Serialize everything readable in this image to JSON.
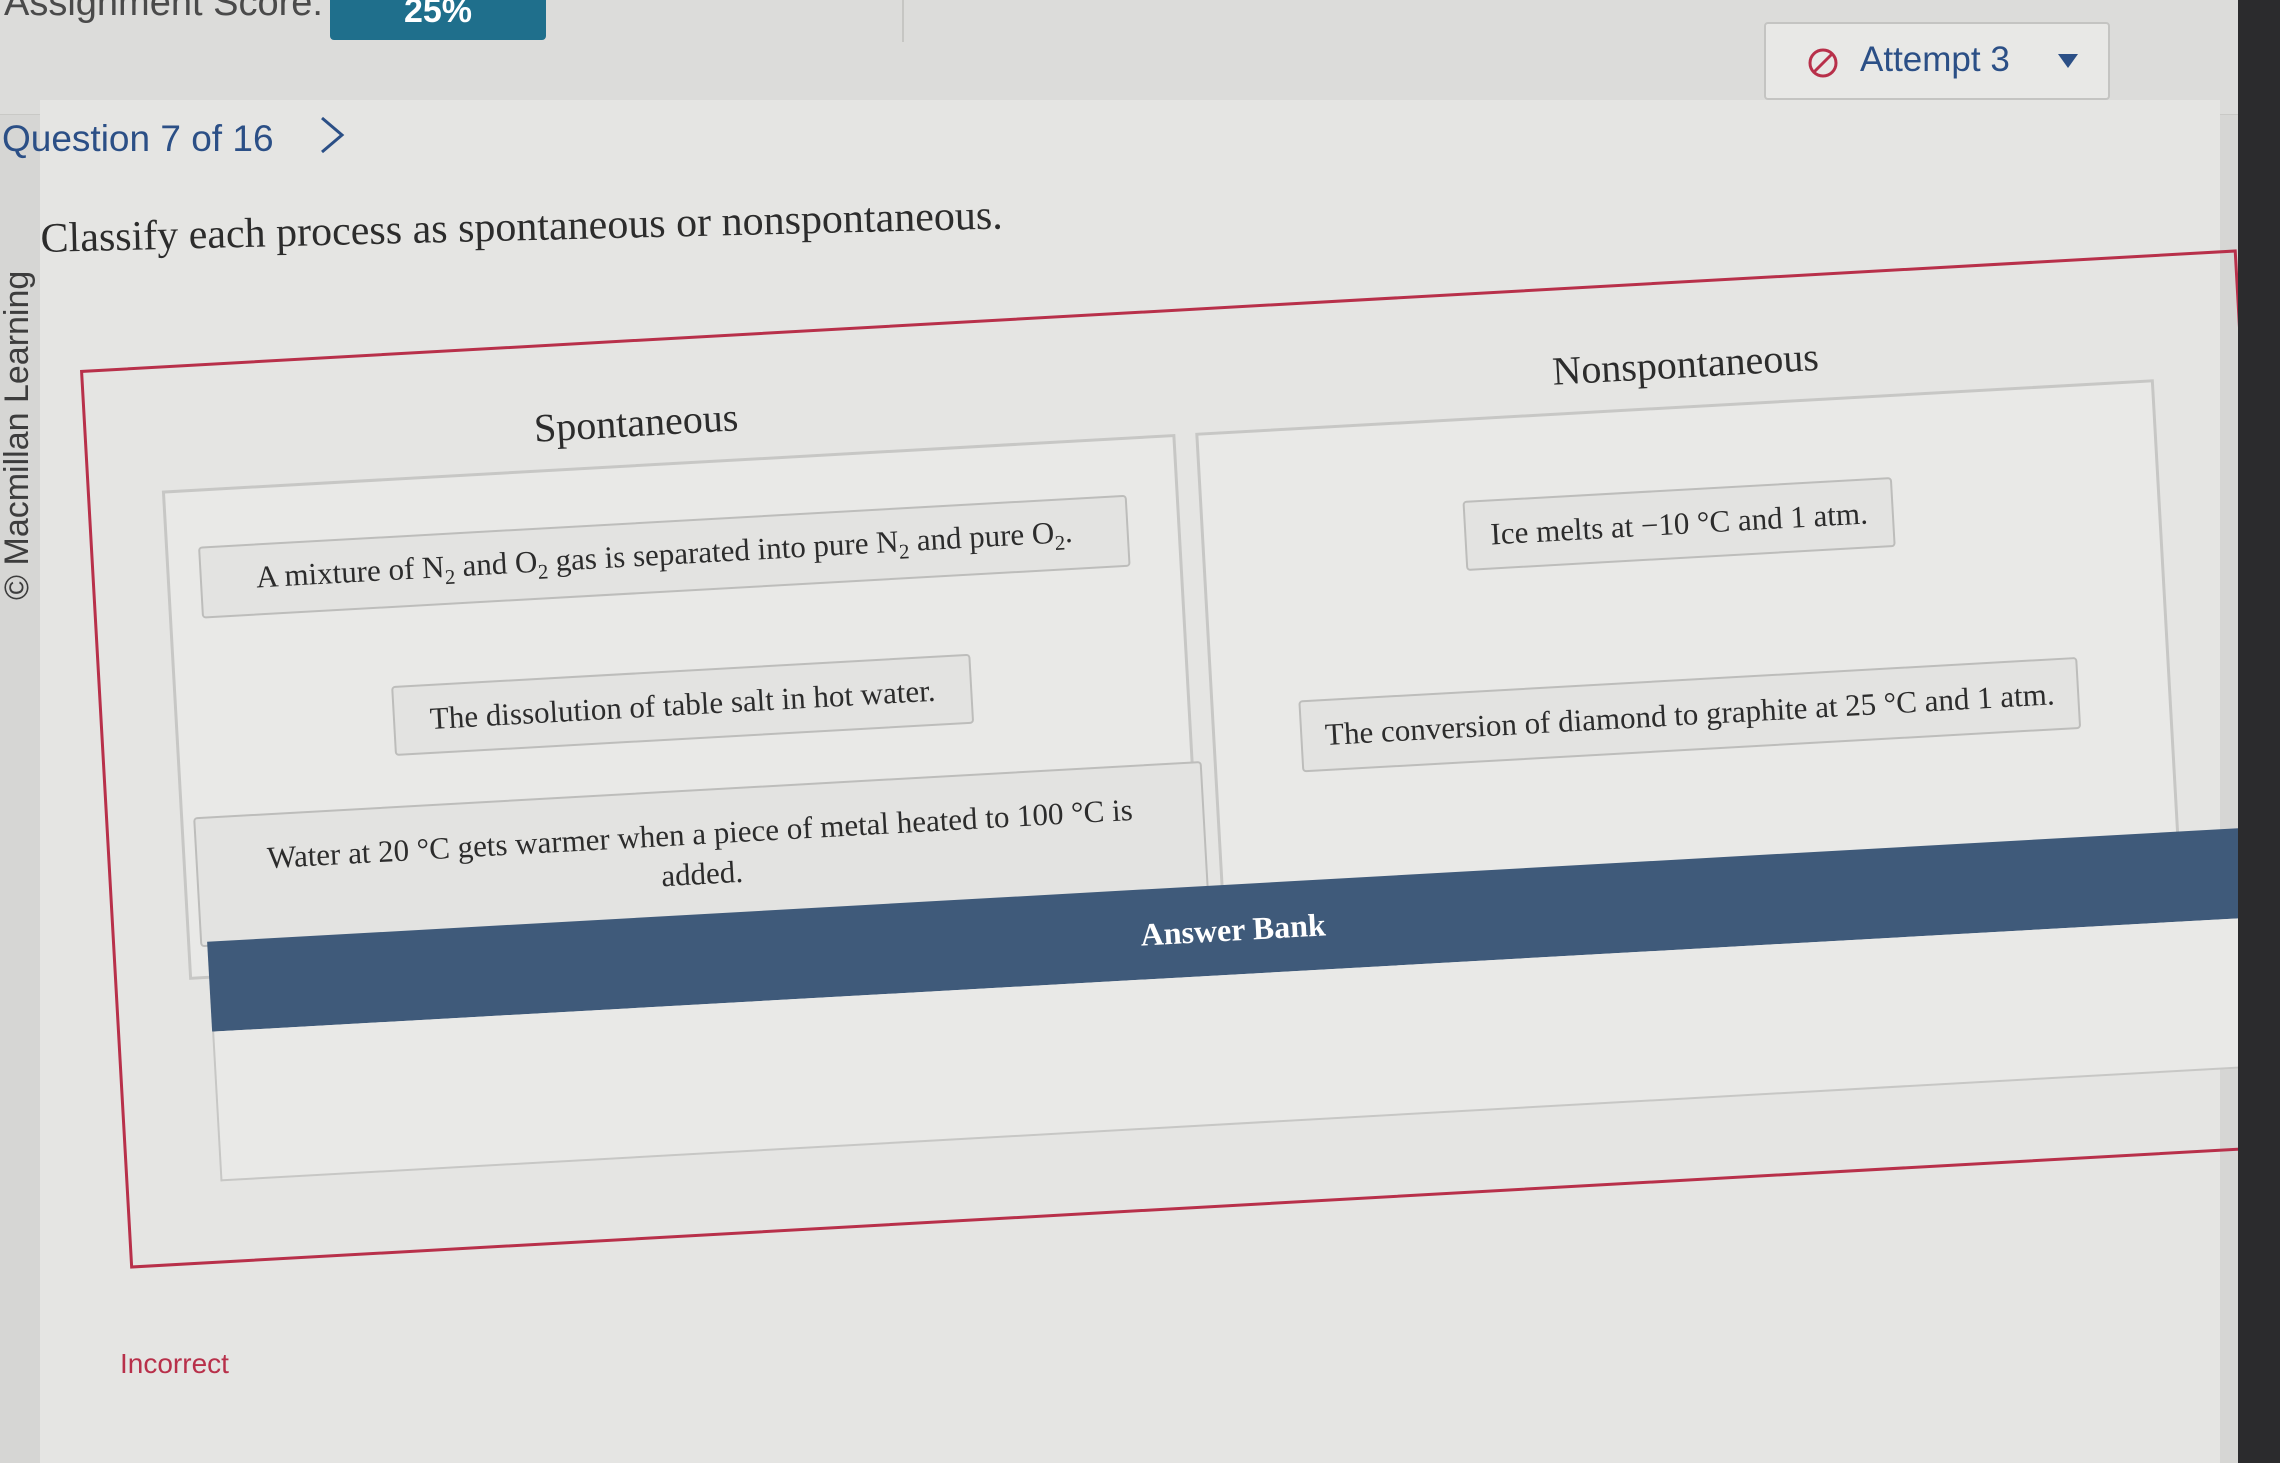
{
  "header": {
    "score_label": "Assignment Score:",
    "score_value": "25%",
    "attempt_label": "Attempt 3"
  },
  "navigation": {
    "question_label": "Question 7 of 16"
  },
  "sidebar_credit": "© Macmillan Learning",
  "question": {
    "prompt": "Classify each process as spontaneous or nonspontaneous."
  },
  "zones": {
    "spontaneous": {
      "title": "Spontaneous",
      "items": [
        "A mixture of N2 and O2 gas is separated into pure N2 and pure O2.",
        "The dissolution of table salt in hot water.",
        "Water at 20 °C gets warmer when a piece of metal heated to 100 °C is added."
      ]
    },
    "nonspontaneous": {
      "title": "Nonspontaneous",
      "items": [
        "Ice melts at −10 °C and 1 atm.",
        "The conversion of diamond to graphite at 25 °C and 1 atm."
      ]
    }
  },
  "answer_bank": {
    "title": "Answer Bank"
  },
  "status": {
    "text": "Incorrect"
  },
  "colors": {
    "accent_blue": "#2b4f86",
    "badge": "#1f6f8c",
    "error_red": "#b8304a",
    "bank_header": "#3f5a7a"
  }
}
